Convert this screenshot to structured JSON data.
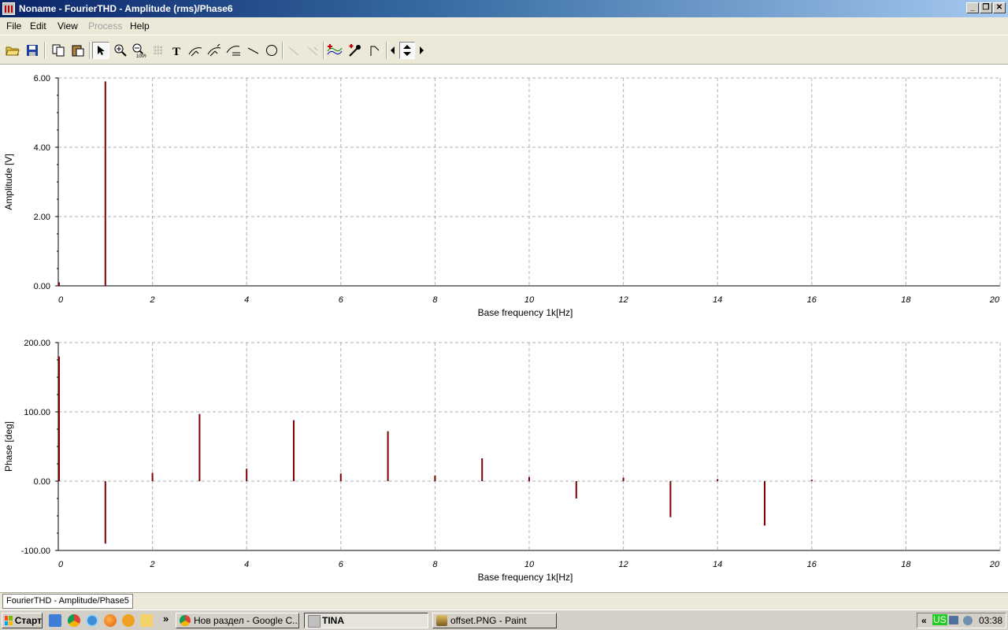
{
  "window": {
    "title": "Noname - FourierTHD - Amplitude (rms)/Phase6"
  },
  "menu": [
    {
      "label": "File",
      "enabled": true
    },
    {
      "label": "Edit",
      "enabled": true
    },
    {
      "label": "View",
      "enabled": true
    },
    {
      "label": "Process",
      "enabled": false
    },
    {
      "label": "Help",
      "enabled": true
    }
  ],
  "toolbar": {
    "buttons": [
      "open-file",
      "save",
      "copy",
      "paste",
      "select-arrow",
      "zoom-in",
      "zoom-100",
      "grid",
      "text",
      "curve-label",
      "curve-label-2",
      "curve-legend",
      "line",
      "ellipse",
      "disabled-1",
      "disabled-2",
      "add-curve",
      "cursor-probe",
      "markers",
      "arrow-left",
      "arrow-up-down",
      "arrow-right"
    ]
  },
  "chart_data": [
    {
      "type": "bar",
      "ylabel": "Amplitude [V]",
      "xlabel": "Base frequency 1k[Hz]",
      "xlim": [
        0,
        20
      ],
      "ylim": [
        0,
        6
      ],
      "xticks": [
        "0",
        "2",
        "4",
        "6",
        "8",
        "10",
        "12",
        "14",
        "16",
        "18",
        "20"
      ],
      "yticks": [
        "0.00",
        "2.00",
        "4.00",
        "6.00"
      ],
      "grid": true,
      "color": "#800000",
      "x": [
        0,
        1
      ],
      "values": [
        0.1,
        5.9
      ]
    },
    {
      "type": "bar",
      "ylabel": "Phase [deg]",
      "xlabel": "Base frequency 1k[Hz]",
      "xlim": [
        0,
        20
      ],
      "ylim": [
        -100,
        200
      ],
      "xticks": [
        "0",
        "2",
        "4",
        "6",
        "8",
        "10",
        "12",
        "14",
        "16",
        "18",
        "20"
      ],
      "yticks": [
        "-100.00",
        "0.00",
        "100.00",
        "200.00"
      ],
      "grid": true,
      "color": "#800000",
      "x": [
        0,
        1,
        2,
        3,
        4,
        5,
        6,
        7,
        8,
        9,
        10,
        11,
        12,
        13,
        14,
        15,
        16
      ],
      "values": [
        180,
        -90,
        12,
        97,
        18,
        88,
        11,
        72,
        8,
        33,
        6,
        -25,
        5,
        -52,
        3,
        -64,
        2
      ]
    }
  ],
  "doc_tab": {
    "label": "FourierTHD - Amplitude/Phase5"
  },
  "taskbar": {
    "start_label": "Старт",
    "chevron": "»",
    "tasks": [
      {
        "label": "Нов раздел - Google C...",
        "active": false
      },
      {
        "label": "TINA",
        "active": true
      },
      {
        "label": "offset.PNG - Paint",
        "active": false
      }
    ],
    "tray": {
      "collapse": "«",
      "lang": "US",
      "time": "03:38"
    }
  }
}
